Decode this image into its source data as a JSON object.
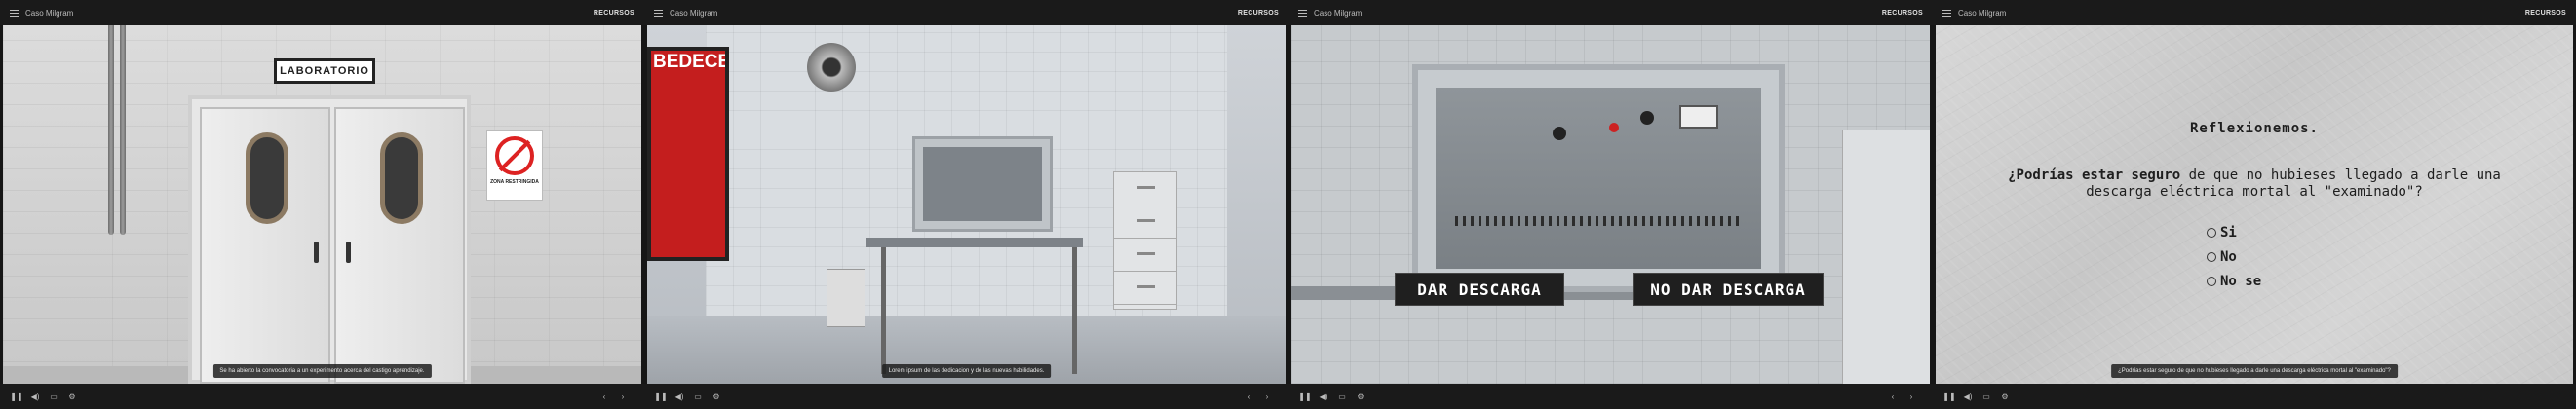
{
  "app": {
    "course_title": "Caso Milgram",
    "resources_label": "RECURSOS"
  },
  "panels": [
    {
      "caption": "Se ha abierto la convocatoria a un experimento acerca del castigo aprendizaje.",
      "scene": {
        "sign_text": "LABORATORIO",
        "warning_text": "ZONA RESTRINGIDA"
      }
    },
    {
      "caption": "Lorem ipsum de las dedicacion y de las nuevas habilidades.",
      "scene": {
        "poster_text": "BEDECBEDECBEDECBEDECBEDECBEDECBEDECBEDEC"
      }
    },
    {
      "caption": "",
      "scene": {
        "button_shock": "DAR DESCARGA",
        "button_no_shock": "NO DAR DESCARGA"
      }
    },
    {
      "caption": "¿Podrías estar seguro de que no hubieses llegado a darle una descarga eléctrica mortal al \"examinado\"?",
      "scene": {
        "heading": "Reflexionemos.",
        "question_bold": "¿Podrías estar seguro",
        "question_rest": " de que no hubieses llegado a darle una descarga eléctrica mortal al \"examinado\"?",
        "options": [
          "Si",
          "No",
          "No se"
        ]
      }
    }
  ],
  "controls": {
    "play_icon": "play-icon",
    "volume_icon": "volume-icon",
    "captions_icon": "captions-icon",
    "settings_icon": "gear-icon",
    "prev_icon": "chevron-left-icon",
    "next_icon": "chevron-right-icon"
  }
}
